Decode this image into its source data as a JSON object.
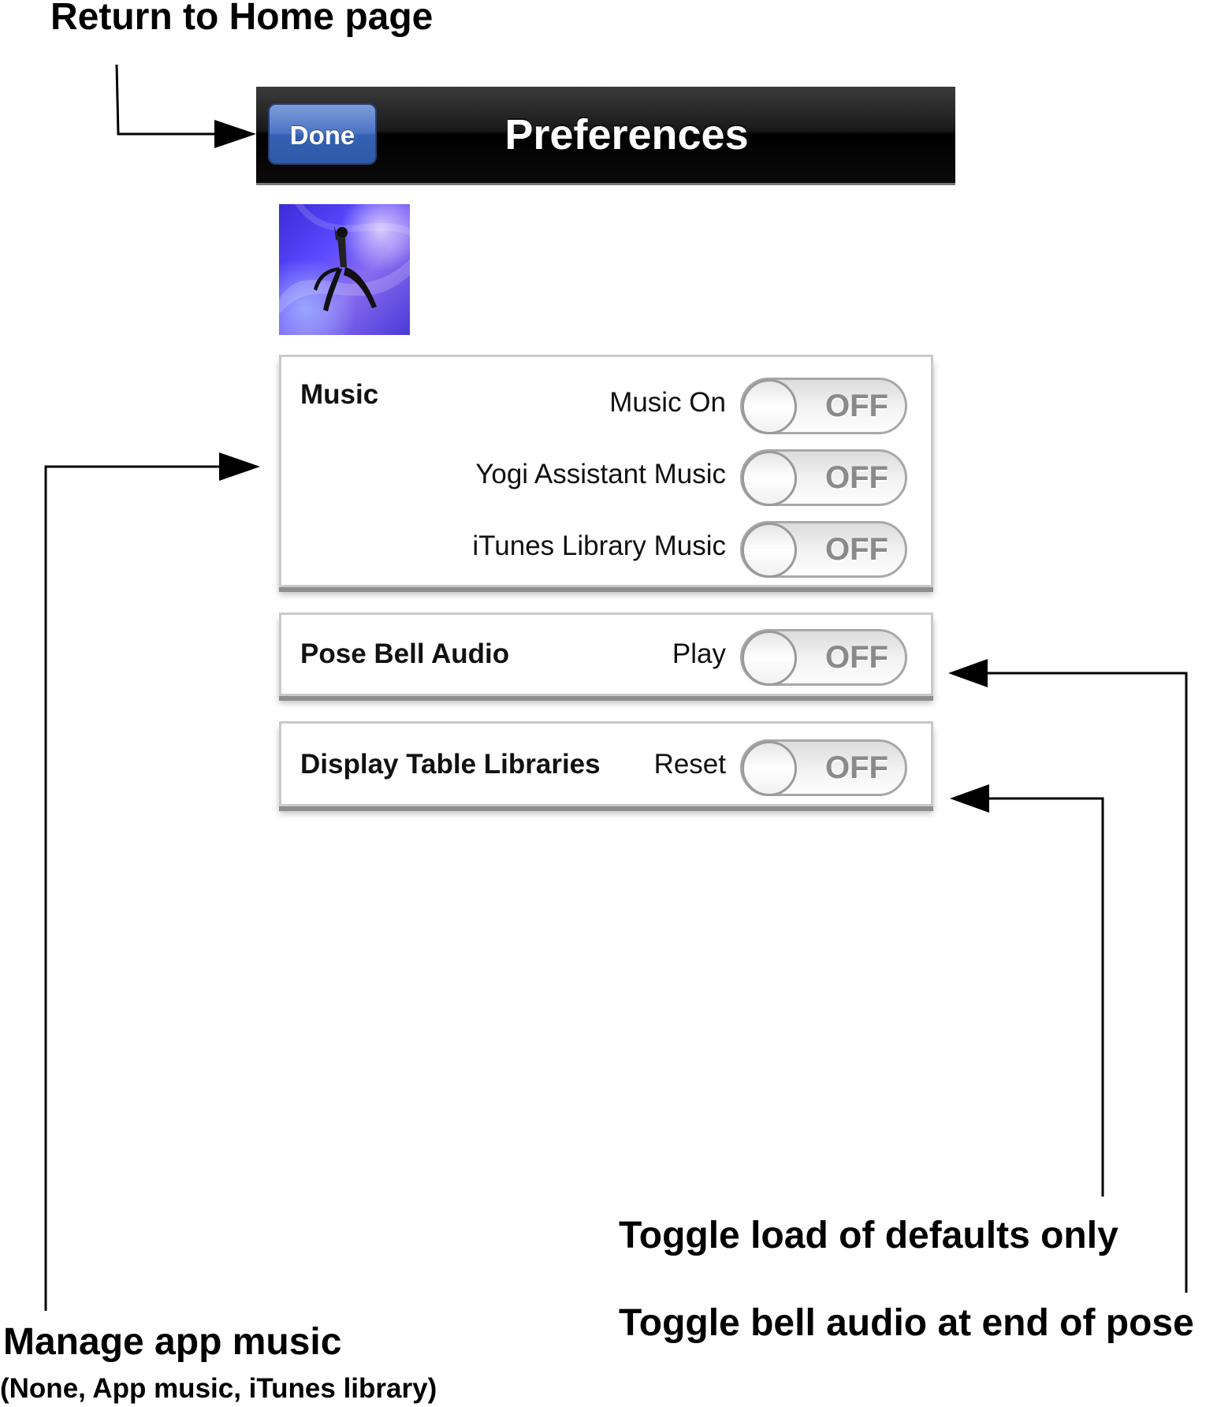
{
  "annotations": {
    "return_home": "Return to Home page",
    "manage_music": "Manage app music",
    "manage_music_sub": "(None, App music, iTunes library)",
    "toggle_defaults": "Toggle load of defaults only",
    "toggle_bell": "Toggle bell audio at end of pose"
  },
  "navbar": {
    "done_label": "Done",
    "title": "Preferences"
  },
  "app_icon": "yoga-pose-icon",
  "music_group": {
    "title": "Music",
    "rows": [
      {
        "label": "Music On",
        "state": "OFF"
      },
      {
        "label": "Yogi Assistant Music",
        "state": "OFF"
      },
      {
        "label": "iTunes Library Music",
        "state": "OFF"
      }
    ]
  },
  "bell_group": {
    "title": "Pose Bell Audio",
    "label": "Play",
    "state": "OFF"
  },
  "display_group": {
    "title": "Display Table Libraries",
    "label": "Reset",
    "state": "OFF"
  }
}
